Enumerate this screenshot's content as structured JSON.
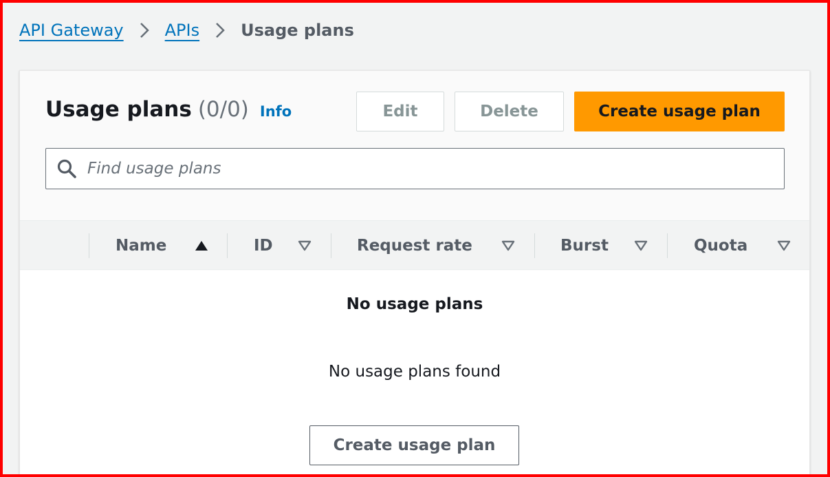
{
  "breadcrumb": {
    "items": [
      "API Gateway",
      "APIs"
    ],
    "current": "Usage plans"
  },
  "panel": {
    "title": "Usage plans",
    "count": "(0/0)",
    "info": "Info"
  },
  "actions": {
    "edit": "Edit",
    "delete": "Delete",
    "create": "Create usage plan"
  },
  "search": {
    "placeholder": "Find usage plans",
    "value": ""
  },
  "table": {
    "columns": [
      {
        "label": "Name",
        "sort": "ascending"
      },
      {
        "label": "ID",
        "sort": "none"
      },
      {
        "label": "Request rate",
        "sort": "none"
      },
      {
        "label": "Burst",
        "sort": "none"
      },
      {
        "label": "Quota",
        "sort": "none"
      }
    ]
  },
  "empty": {
    "title": "No usage plans",
    "description": "No usage plans found",
    "button": "Create usage plan"
  },
  "colors": {
    "link": "#0073bb",
    "primary": "#ff9900",
    "frame": "#ff0000"
  }
}
